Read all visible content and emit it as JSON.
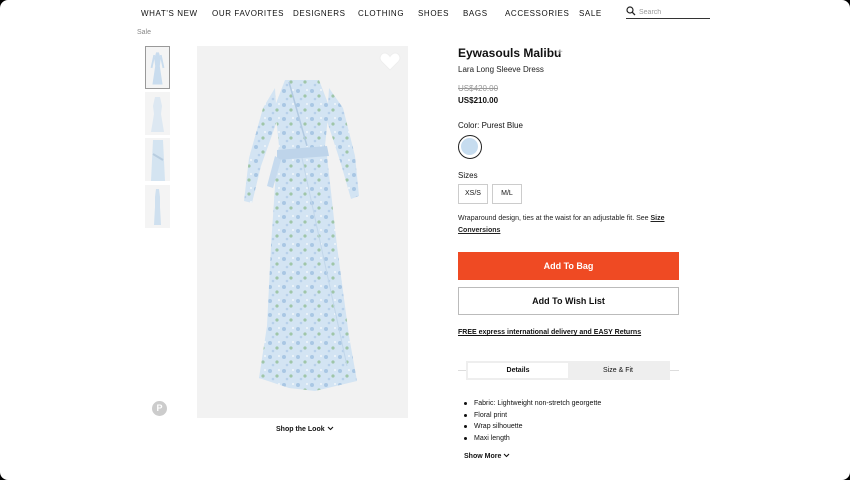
{
  "nav": {
    "items": [
      "WHAT'S NEW",
      "OUR FAVORITES",
      "DESIGNERS",
      "CLOTHING",
      "SHOES",
      "BAGS",
      "ACCESSORIES",
      "SALE"
    ],
    "search_placeholder": "Search"
  },
  "breadcrumb": "Sale",
  "gallery": {
    "thumbnail_count": 4,
    "shop_the_look": "Shop the Look"
  },
  "product": {
    "brand": "Eywasouls Malibu",
    "brand_follow_icon": "+",
    "name": "Lara Long Sleeve Dress",
    "price_original": "US$420.00",
    "price_sale": "US$210.00",
    "color_label": "Color: Purest Blue",
    "swatch_color": "#c6dcef",
    "sizes_label": "Sizes",
    "sizes": [
      "XS/S",
      "M/L"
    ],
    "description": "Wraparound design, ties at the waist for an adjustable fit.  See ",
    "size_link": "Size Conversions",
    "add_to_bag": "Add To Bag",
    "add_to_wishlist": "Add To Wish List",
    "delivery": "FREE express international delivery and EASY Returns",
    "tabs": [
      "Details",
      "Size & Fit"
    ],
    "details": [
      "Fabric: Lightweight non-stretch georgette",
      "Floral print",
      "Wrap silhouette",
      "Maxi length"
    ],
    "show_more": "Show More"
  },
  "colors": {
    "accent": "#ef4a23"
  },
  "icons": {
    "search": "search-icon",
    "heart": "heart-icon",
    "pinterest": "pinterest-icon",
    "chevron": "chevron-down-icon"
  }
}
